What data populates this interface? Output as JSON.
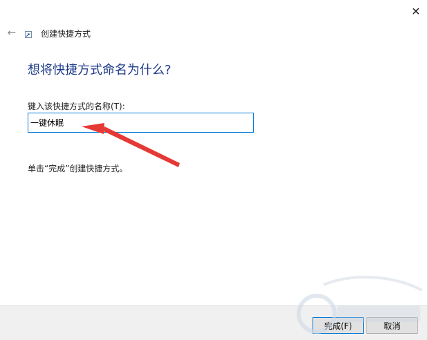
{
  "wizard": {
    "title": "创建快捷方式",
    "heading": "想将快捷方式命名为什么?",
    "field_label": "键入该快捷方式的名称(T):",
    "field_value": "一键休眠",
    "hint": "单击“完成”创建快捷方式。"
  },
  "titlebar": {
    "close_glyph": "✕",
    "back_glyph": "←"
  },
  "footer": {
    "finish_label": "完成(F)",
    "cancel_label": "取消"
  },
  "colors": {
    "heading": "#1e3a8a",
    "input_border": "#0078d7",
    "annotation_arrow": "#e53935"
  },
  "icons": [
    "close-icon",
    "back-arrow-icon",
    "shortcut-icon",
    "annotation-arrow"
  ]
}
